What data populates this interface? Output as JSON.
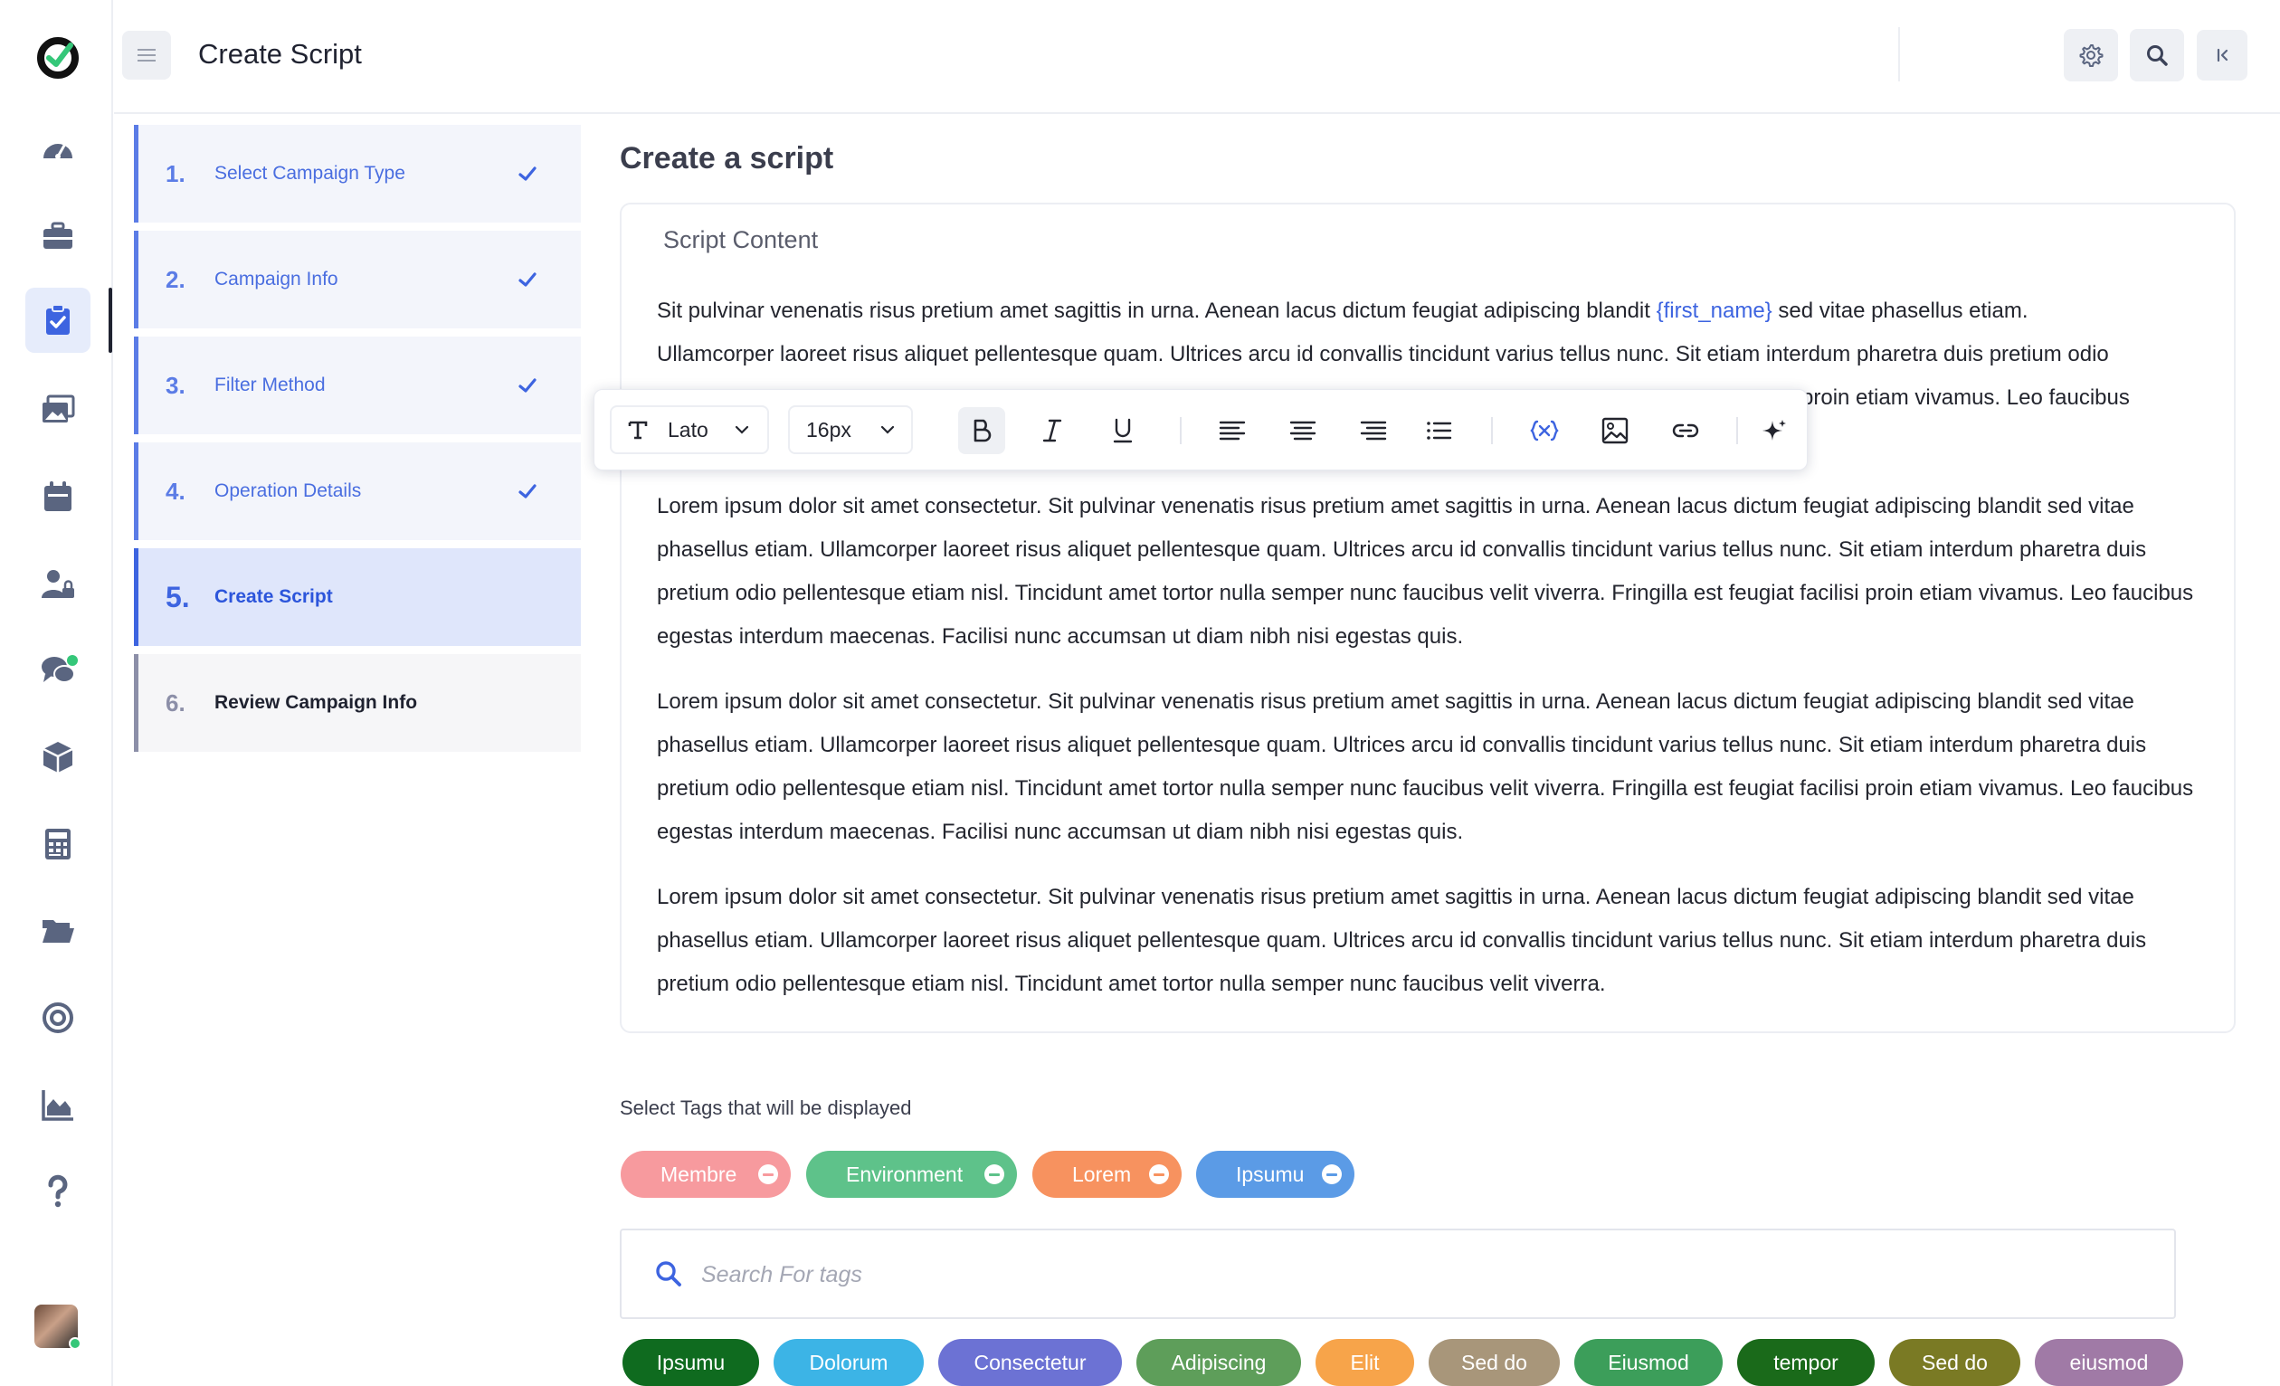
{
  "header": {
    "title": "Create Script"
  },
  "steps": [
    {
      "num": "1.",
      "label": "Select Campaign Type",
      "status": "done"
    },
    {
      "num": "2.",
      "label": "Campaign Info",
      "status": "done"
    },
    {
      "num": "3.",
      "label": "Filter Method",
      "status": "done"
    },
    {
      "num": "4.",
      "label": "Operation Details",
      "status": "done"
    },
    {
      "num": "5.",
      "label": "Create Script",
      "status": "active"
    },
    {
      "num": "6.",
      "label": "Review Campaign Info",
      "status": "pending"
    }
  ],
  "main": {
    "title": "Create a script",
    "card_title": "Script Content",
    "para1_line1_a": "Sit pulvinar venenatis risus pretium amet sagittis in urna. Aenean lacus dictum feugiat adipiscing blandit ",
    "para1_variable": "{first_name}",
    "para1_line1_b": " sed vitae phasellus etiam.",
    "para1_line2": "Ullamcorper laoreet risus aliquet pellentesque quam. Ultrices arcu id convallis tincidunt varius tellus nunc. Sit etiam interdum pharetra duis pretium odio",
    "para1_line3_visible": "proin etiam vivamus. Leo faucibus",
    "paragraphs": [
      "Lorem ipsum dolor sit amet consectetur. Sit pulvinar venenatis risus pretium amet sagittis in urna. Aenean lacus dictum feugiat adipiscing blandit sed vitae phasellus etiam. Ullamcorper laoreet risus aliquet pellentesque quam. Ultrices arcu id convallis tincidunt varius tellus nunc. Sit etiam interdum pharetra duis pretium odio pellentesque etiam nisl. Tincidunt amet tortor nulla semper nunc faucibus velit viverra. Fringilla est feugiat facilisi proin etiam vivamus. Leo faucibus egestas interdum maecenas. Facilisi nunc accumsan ut diam nibh nisi egestas quis.",
      "Lorem ipsum dolor sit amet consectetur. Sit pulvinar venenatis risus pretium amet sagittis in urna. Aenean lacus dictum feugiat adipiscing blandit sed vitae phasellus etiam. Ullamcorper laoreet risus aliquet pellentesque quam. Ultrices arcu id convallis tincidunt varius tellus nunc. Sit etiam interdum pharetra duis pretium odio pellentesque etiam nisl. Tincidunt amet tortor nulla semper nunc faucibus velit viverra. Fringilla est feugiat facilisi proin etiam vivamus. Leo faucibus egestas interdum maecenas. Facilisi nunc accumsan ut diam nibh nisi egestas quis.",
      "Lorem ipsum dolor sit amet consectetur. Sit pulvinar venenatis risus pretium amet sagittis in urna. Aenean lacus dictum feugiat adipiscing blandit sed vitae phasellus etiam. Ullamcorper laoreet risus aliquet pellentesque quam. Ultrices arcu id convallis tincidunt varius tellus nunc. Sit etiam interdum pharetra duis pretium odio pellentesque etiam nisl. Tincidunt amet tortor nulla semper nunc faucibus velit viverra."
    ]
  },
  "toolbar": {
    "font_family": "Lato",
    "font_size": "16px",
    "buttons": [
      "bold-icon",
      "italic-icon",
      "underline-icon",
      "align-left-icon",
      "align-center-icon",
      "align-right-icon",
      "bullet-list-icon",
      "variable-icon",
      "image-icon",
      "link-icon",
      "sparkle-icon"
    ]
  },
  "tags": {
    "label": "Select Tags that will be displayed",
    "selected": [
      {
        "label": "Membre",
        "color": "#f79a9e"
      },
      {
        "label": "Environment",
        "color": "#5ec28a"
      },
      {
        "label": "Lorem",
        "color": "#f7925f"
      },
      {
        "label": "Ipsumu",
        "color": "#5b9be6"
      }
    ],
    "search_placeholder": "Search For tags",
    "available": [
      {
        "label": "Ipsumu",
        "color": "#0f6b1f"
      },
      {
        "label": "Dolorum",
        "color": "#3cb4e6"
      },
      {
        "label": "Consectetur",
        "color": "#6c72d4"
      },
      {
        "label": "Adipiscing",
        "color": "#5e9e5a"
      },
      {
        "label": "Elit",
        "color": "#f7a44a"
      },
      {
        "label": "Sed do",
        "color": "#a8967a"
      },
      {
        "label": "Eiusmod",
        "color": "#3c9e5a"
      },
      {
        "label": "tempor",
        "color": "#1a6a1a"
      },
      {
        "label": "Sed do",
        "color": "#7a7a24"
      },
      {
        "label": "eiusmod",
        "color": "#a07aa6"
      }
    ]
  },
  "colors": {
    "accent": "#3d64e0",
    "nav_icon": "#5a6580"
  }
}
